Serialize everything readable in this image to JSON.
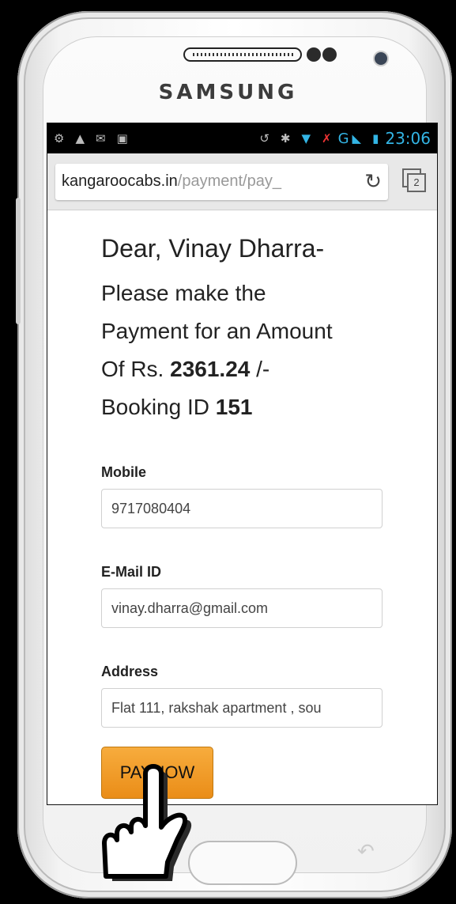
{
  "device": {
    "brand": "SAMSUNG"
  },
  "status_bar": {
    "network": "G",
    "time": "23:06"
  },
  "browser": {
    "url_host": "kangaroocabs.in",
    "url_path": "/payment/pay_",
    "tab_count": "2"
  },
  "page": {
    "greeting": "Dear, Vinay Dharra-",
    "message_line1": "Please make the",
    "message_line2": "Payment for an Amount",
    "amount_prefix": "Of Rs. ",
    "amount": "2361.24",
    "amount_suffix": " /-",
    "booking_prefix": "Booking ID ",
    "booking_id": "151",
    "mobile_label": "Mobile",
    "mobile_value": "9717080404",
    "email_label": "E-Mail ID",
    "email_value": "vinay.dharra@gmail.com",
    "address_label": "Address",
    "address_value": "Flat 111, rakshak apartment , sou",
    "pay_button": "PAYNOW"
  },
  "colors": {
    "accent_status": "#33b5e5",
    "button_orange": "#f0a030"
  }
}
